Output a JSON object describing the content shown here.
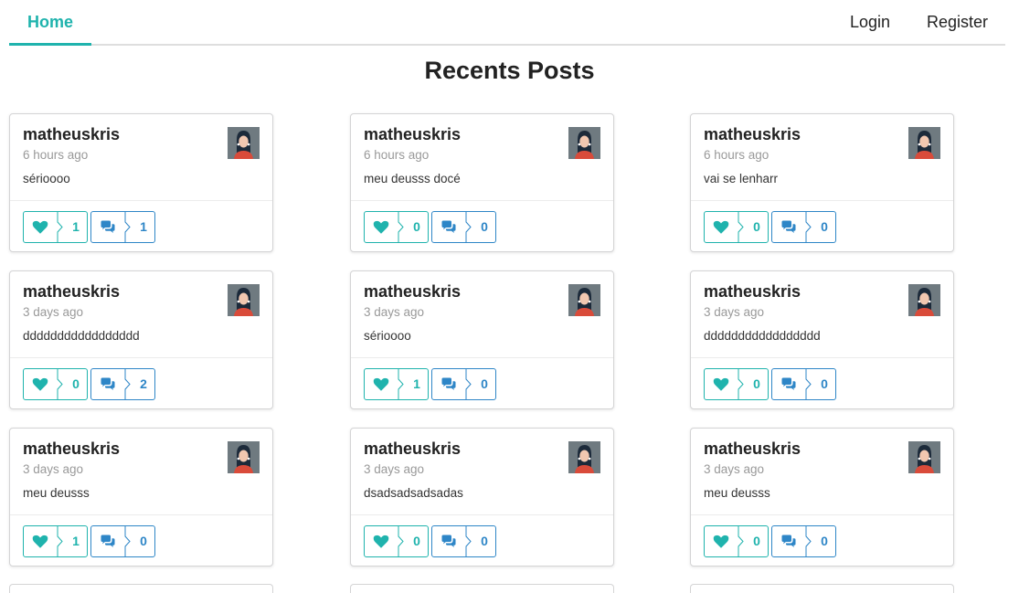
{
  "nav": {
    "home": "Home",
    "login": "Login",
    "register": "Register"
  },
  "page": {
    "title": "Recents Posts"
  },
  "posts": [
    {
      "author": "matheuskris",
      "time": "6 hours ago",
      "text": "sérioooo",
      "likes": "1",
      "comments": "1"
    },
    {
      "author": "matheuskris",
      "time": "6 hours ago",
      "text": "meu deusss docé",
      "likes": "0",
      "comments": "0"
    },
    {
      "author": "matheuskris",
      "time": "6 hours ago",
      "text": "vai se lenharr",
      "likes": "0",
      "comments": "0"
    },
    {
      "author": "matheuskris",
      "time": "3 days ago",
      "text": "ddddddddddddddddd",
      "likes": "0",
      "comments": "2"
    },
    {
      "author": "matheuskris",
      "time": "3 days ago",
      "text": "sérioooo",
      "likes": "1",
      "comments": "0"
    },
    {
      "author": "matheuskris",
      "time": "3 days ago",
      "text": "ddddddddddddddddd",
      "likes": "0",
      "comments": "0"
    },
    {
      "author": "matheuskris",
      "time": "3 days ago",
      "text": "meu deusss",
      "likes": "1",
      "comments": "0"
    },
    {
      "author": "matheuskris",
      "time": "3 days ago",
      "text": "dsadsadsadsadas",
      "likes": "0",
      "comments": "0"
    },
    {
      "author": "matheuskris",
      "time": "3 days ago",
      "text": "meu deusss",
      "likes": "0",
      "comments": "0"
    }
  ],
  "colors": {
    "accent": "#1fb3ad",
    "comment": "#2e86c7"
  },
  "icons": {
    "like": "heart-icon",
    "comment": "comments-icon"
  }
}
